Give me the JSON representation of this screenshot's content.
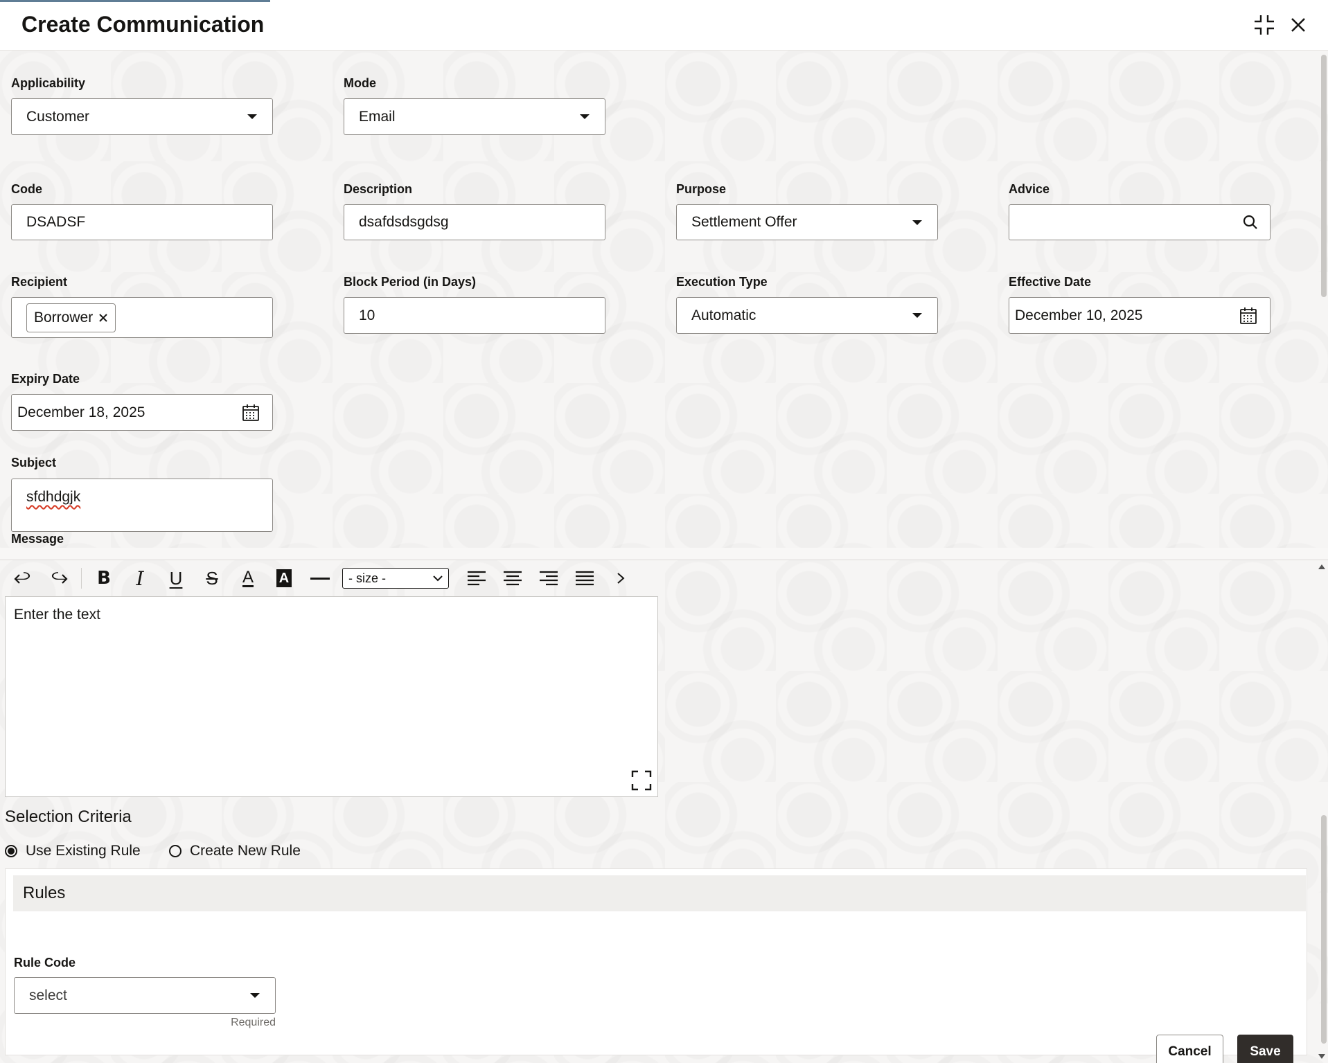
{
  "window": {
    "title": "Create Communication"
  },
  "form": {
    "applicability": {
      "label": "Applicability",
      "value": "Customer"
    },
    "mode": {
      "label": "Mode",
      "value": "Email"
    },
    "code": {
      "label": "Code",
      "value": "DSADSF"
    },
    "description": {
      "label": "Description",
      "value": "dsafdsdsgdsg"
    },
    "purpose": {
      "label": "Purpose",
      "value": "Settlement Offer"
    },
    "advice": {
      "label": "Advice",
      "value": ""
    },
    "recipient": {
      "label": "Recipient",
      "chips": [
        "Borrower"
      ]
    },
    "block_period": {
      "label": "Block Period (in Days)",
      "value": "10"
    },
    "execution_type": {
      "label": "Execution Type",
      "value": "Automatic"
    },
    "effective_date": {
      "label": "Effective Date",
      "value": "December 10, 2025"
    },
    "expiry_date": {
      "label": "Expiry Date",
      "value": "December 18, 2025"
    },
    "subject": {
      "label": "Subject",
      "value": "sfdhdgjk"
    },
    "message": {
      "label": "Message"
    }
  },
  "editor": {
    "size_select": "- size -",
    "placeholder": "Enter the text"
  },
  "selection": {
    "title": "Selection Criteria",
    "options": [
      "Use Existing Rule",
      "Create New Rule"
    ],
    "selected": "Use Existing Rule"
  },
  "rules": {
    "title": "Rules",
    "rule_code": {
      "label": "Rule Code",
      "value": "select",
      "hint": "Required"
    }
  },
  "actions": {
    "cancel": "Cancel",
    "save": "Save"
  }
}
